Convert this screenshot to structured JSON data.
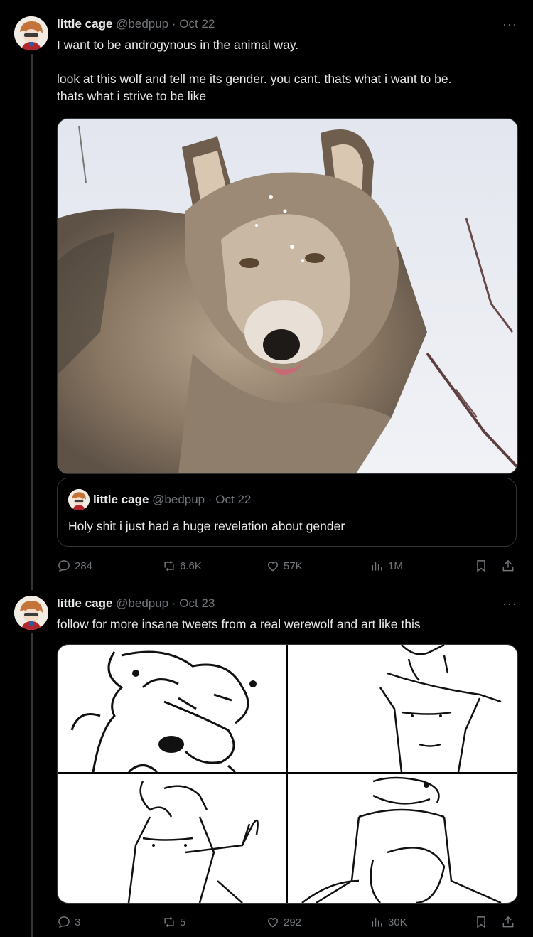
{
  "tweets": [
    {
      "author_name": "little cage",
      "handle": "@bedpup",
      "separator": "·",
      "date": "Oct 22",
      "more_label": "···",
      "text_line1": "I want to be androgynous in the animal way.",
      "text_line2": "look at this wolf and tell me its gender. you cant. thats what i want to be.",
      "text_line3": "thats what i strive to be like",
      "quote": {
        "author_name": "little cage",
        "handle": "@bedpup",
        "separator": "·",
        "date": "Oct 22",
        "text": "Holy shit i just had a huge revelation about gender"
      },
      "stats": {
        "replies": "284",
        "reposts": "6.6K",
        "likes": "57K",
        "views": "1M"
      }
    },
    {
      "author_name": "little cage",
      "handle": "@bedpup",
      "separator": "·",
      "date": "Oct 23",
      "more_label": "···",
      "text": "follow for more insane tweets from a real werewolf and art like this",
      "stats": {
        "replies": "3",
        "reposts": "5",
        "likes": "292",
        "views": "30K"
      }
    }
  ],
  "colors": {
    "background": "#000000",
    "text": "#e7e9ea",
    "muted": "#71767b",
    "border": "#2f3336"
  },
  "icons": [
    "reply-icon",
    "repost-icon",
    "like-icon",
    "views-icon",
    "bookmark-icon",
    "share-icon",
    "more-icon"
  ]
}
